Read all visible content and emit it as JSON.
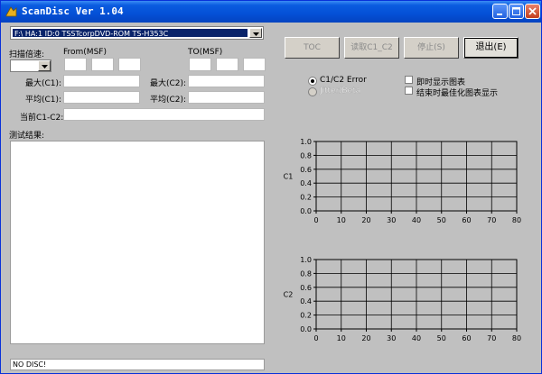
{
  "window": {
    "title": "ScanDisc Ver 1.04",
    "controls": [
      "minimize",
      "maximize",
      "close"
    ]
  },
  "drive_select": {
    "selected": "F:\\ HA:1 ID:0 TSSTcorpDVD-ROM TS-H353C"
  },
  "labels": {
    "scan_speed": "扫描倍速:",
    "from": "From(MSF)",
    "to": "TO(MSF)",
    "max_c1": "最大(C1):",
    "avg_c1": "平均(C1):",
    "max_c2": "最大(C2):",
    "avg_c2": "平均(C2):",
    "current_c1c2": "当前C1-C2:",
    "test_results": "测试结果:"
  },
  "buttons": {
    "toc": "TOC",
    "read_c1c2": "读取C1_C2",
    "stop": "停止(S)",
    "exit": "退出(E)"
  },
  "options": {
    "radio_c1c2": "C1/C2 Error",
    "radio_disabled": "Jitter/Beta",
    "check_realtime": "即时显示图表",
    "check_optimize": "结束时最佳化图表显示"
  },
  "status_text": "NO DISC!",
  "chart_data": [
    {
      "type": "line",
      "ylabel": "C1",
      "xlim": [
        0,
        80
      ],
      "ylim": [
        0,
        1
      ],
      "x_ticks": [
        "0",
        "10",
        "20",
        "30",
        "40",
        "50",
        "60",
        "70",
        "80"
      ],
      "y_ticks": [
        "0.0",
        "0.2",
        "0.4",
        "0.6",
        "0.8",
        "1.0"
      ],
      "grid": true,
      "series": []
    },
    {
      "type": "line",
      "ylabel": "C2",
      "xlim": [
        0,
        80
      ],
      "ylim": [
        0,
        1
      ],
      "x_ticks": [
        "0",
        "10",
        "20",
        "30",
        "40",
        "50",
        "60",
        "70",
        "80"
      ],
      "y_ticks": [
        "0.0",
        "0.2",
        "0.4",
        "0.6",
        "0.8",
        "1.0"
      ],
      "grid": true,
      "series": []
    }
  ]
}
